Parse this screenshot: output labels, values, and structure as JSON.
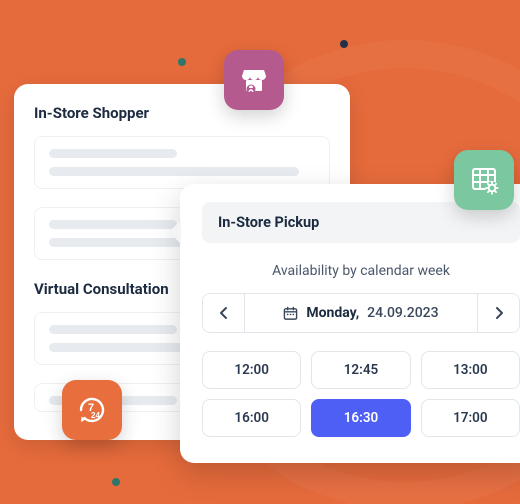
{
  "left_card": {
    "section1_title": "In-Store Shopper",
    "section2_title": "Virtual Consultation"
  },
  "popup": {
    "title": "In-Store Pickup",
    "availability_label": "Availability by calendar week",
    "date": {
      "day": "Monday,",
      "value": "24.09.2023"
    },
    "slots": [
      "12:00",
      "12:45",
      "13:00",
      "16:00",
      "16:30",
      "17:00"
    ],
    "selected_slot": "16:30"
  },
  "tiles": {
    "purple": "store-icon",
    "green": "grid-settings-icon",
    "orange": "seven-twenty-four-icon"
  }
}
